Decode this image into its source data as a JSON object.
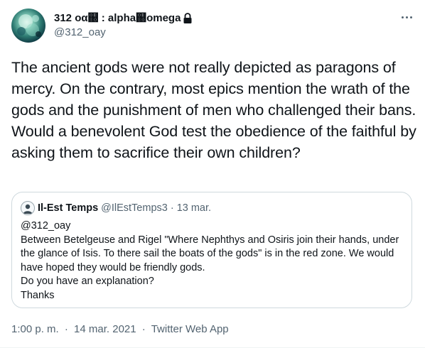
{
  "author": {
    "display_name": "312 οα஀ : alpha஀omega",
    "handle": "@312_oay",
    "avatar_icon": "nebula-avatar",
    "protected_icon": "lock-icon"
  },
  "more_icon": "more-horizontal-icon",
  "tweet_text": "The ancient gods were not really depicted as paragons of mercy. On the contrary, most epics mention the wrath of the gods and the punishment of men who challenged their bans. Would a benevolent God test the obedience of the faithful by asking them to sacrifice their own children?",
  "quoted": {
    "display_name": "Il-Est Temps",
    "handle": "@IlEstTemps3",
    "separator": "·",
    "date": "13 mar.",
    "avatar_icon": "person-avatar",
    "lines": [
      "@312_oay",
      "Between Betelgeuse and Rigel \"Where Nephthys and Osiris join their hands, under the glance of Isis. To there sail the boats of the gods\" is in the red zone. We would have hoped they would be friendly gods.",
      "Do you have an explanation?",
      "Thanks"
    ]
  },
  "meta": {
    "time": "1:00 p. m.",
    "separator": "·",
    "date": "14 mar. 2021",
    "source": "Twitter Web App"
  }
}
